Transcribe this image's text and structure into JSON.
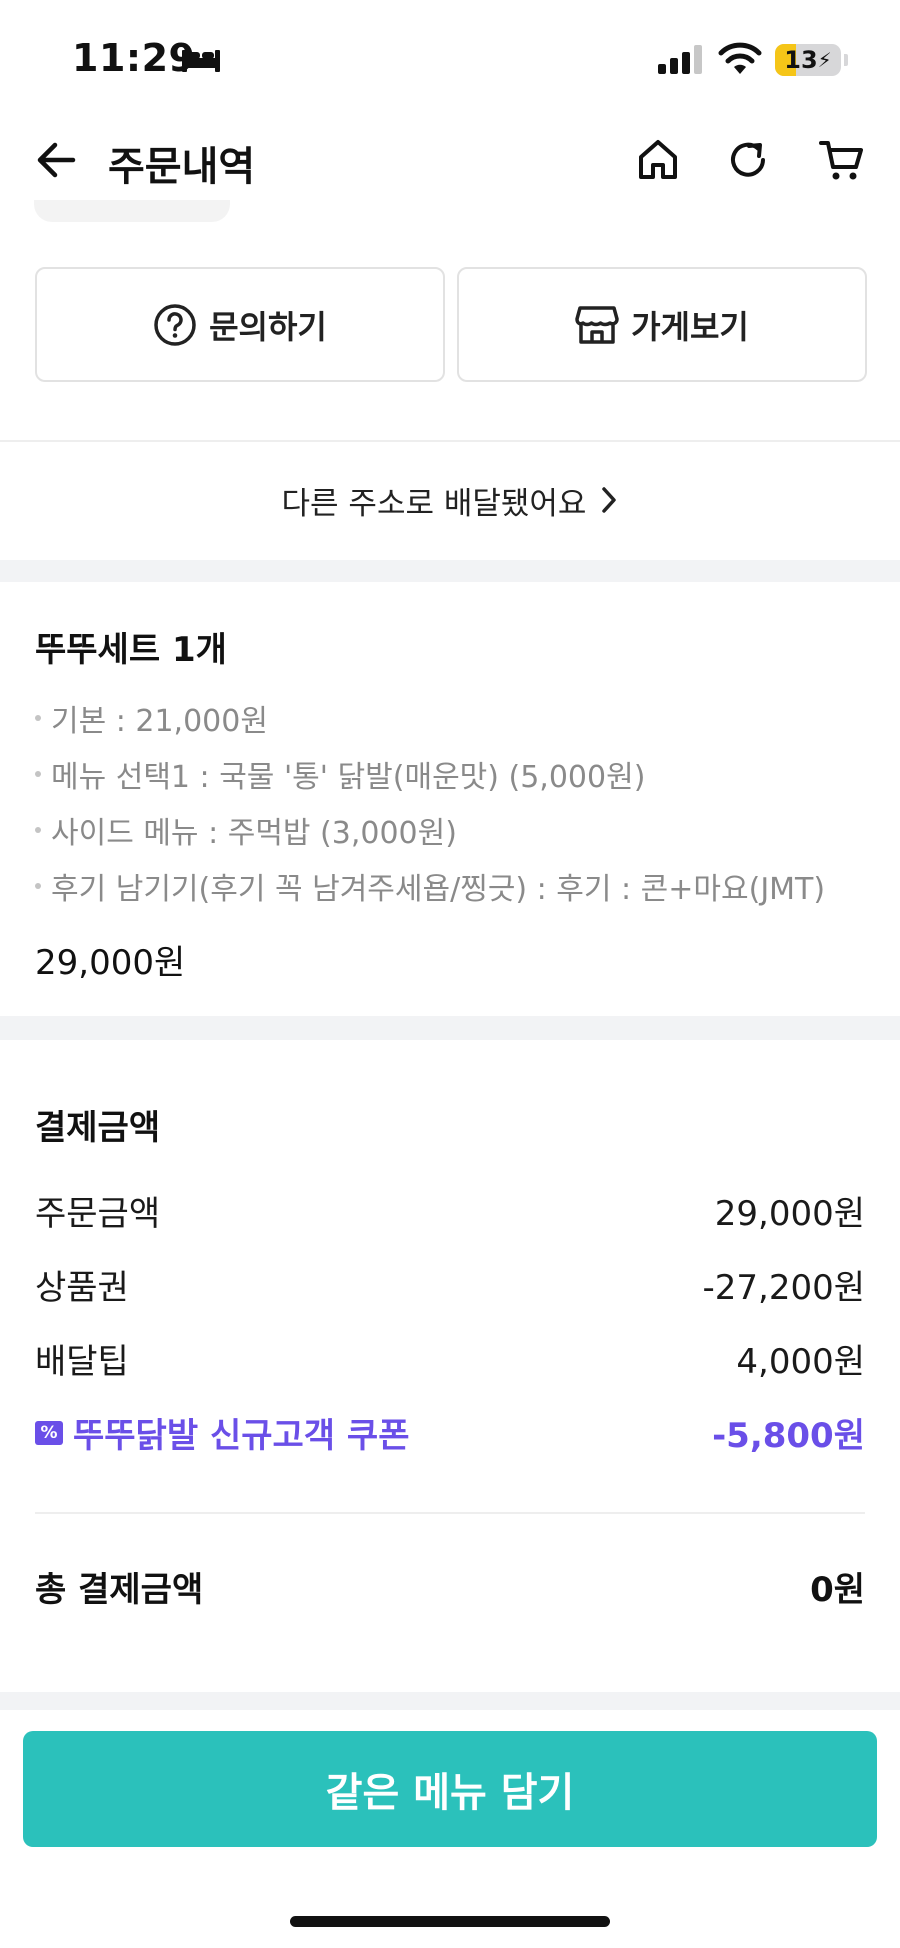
{
  "status_bar": {
    "time": "11:29",
    "battery_level": "13",
    "battery_fraction": 0.13
  },
  "header": {
    "title": "주문내역",
    "icons": [
      "back-arrow-icon",
      "home-icon",
      "refresh-icon",
      "cart-icon"
    ]
  },
  "actions": {
    "inquiry_label": "문의하기",
    "store_label": "가게보기"
  },
  "address_notice": "다른 주소로 배달됐어요",
  "order_item": {
    "title": "뚜뚜세트 1개",
    "options": [
      "기본 : 21,000원",
      "메뉴 선택1 : 국물 '통' 닭발(매운맛) (5,000원)",
      "사이드 메뉴 : 주먹밥 (3,000원)",
      "후기 남기기(후기 꼭 남겨주세욥/찡긋) : 후기 : 콘+마요(JMT)"
    ],
    "price": "29,000원"
  },
  "payment": {
    "title": "결제금액",
    "rows": [
      {
        "label": "주문금액",
        "value": "29,000원"
      },
      {
        "label": "상품권",
        "value": "-27,200원"
      },
      {
        "label": "배달팁",
        "value": "4,000원"
      }
    ],
    "coupon": {
      "label": "뚜뚜닭발 신규고객 쿠폰",
      "value": "-5,800원",
      "icon_glyph": "%"
    },
    "total_label": "총 결제금액",
    "total_value": "0원"
  },
  "cta_label": "같은 메뉴 담기",
  "colors": {
    "accent_teal": "#2bc1bb",
    "coupon_purple": "#6a4fe8",
    "battery_yellow": "#f5c518"
  }
}
